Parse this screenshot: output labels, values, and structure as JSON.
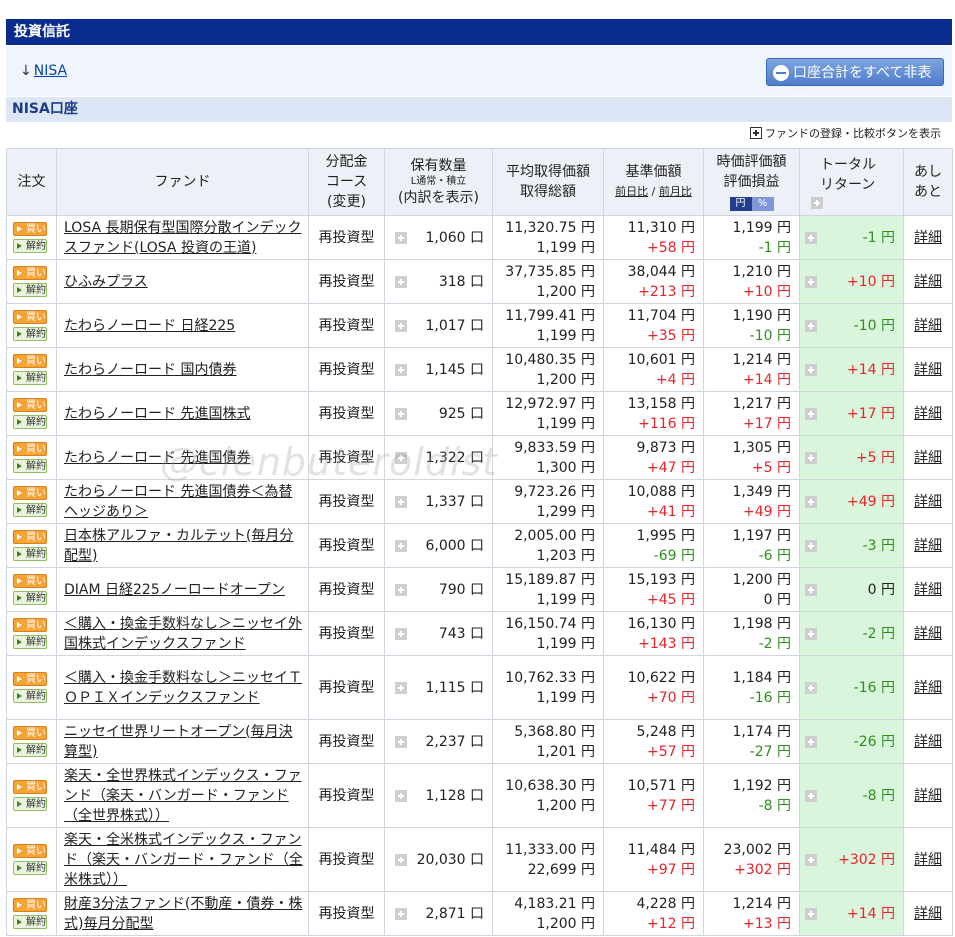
{
  "section_title": "投資信託",
  "nav": {
    "arrow": "↓",
    "nisa_link": "NISA",
    "hide_all_label": "口座合計をすべて非表示"
  },
  "account_title": "NISA口座",
  "compare_label": "ファンドの登録・比較ボタンを表示",
  "headers": {
    "order": "注文",
    "fund": "ファンド",
    "course_l1": "分配金",
    "course_l2": "コース",
    "course_l3": "(変更)",
    "qty_l1": "保有数量",
    "qty_sub": "L通常・積立",
    "qty_l3": "(内訳を表示)",
    "avg_l1": "平均取得価額",
    "avg_l2": "取得総額",
    "base_l1": "基準価額",
    "base_sub_a": "前日比",
    "base_sub_sep": " / ",
    "base_sub_b": "前月比",
    "eval_l1": "時価評価額",
    "eval_l2": "評価損益",
    "toggle_yen": "円",
    "toggle_pct": "%",
    "ret_l1": "トータル",
    "ret_l2": "リターン",
    "ashiato_l1": "あし",
    "ashiato_l2": "あと"
  },
  "buttons": {
    "buy": "買い",
    "sell": "解約",
    "detail": "詳細"
  },
  "rows": [
    {
      "fund": "LOSA 長期保有型国際分散インデックスファンド(LOSA 投資の王道)",
      "course": "再投資型",
      "qty": "1,060 口",
      "avg": "11,320.75 円",
      "total": "1,199 円",
      "base": "11,310 円",
      "base_chg": "+58 円",
      "eval": "1,199 円",
      "pl": "-1 円",
      "ret": "-1 円"
    },
    {
      "fund": "ひふみプラス",
      "course": "再投資型",
      "qty": "318 口",
      "avg": "37,735.85 円",
      "total": "1,200 円",
      "base": "38,044 円",
      "base_chg": "+213 円",
      "eval": "1,210 円",
      "pl": "+10 円",
      "ret": "+10 円"
    },
    {
      "fund": "たわらノーロード 日経225",
      "course": "再投資型",
      "qty": "1,017 口",
      "avg": "11,799.41 円",
      "total": "1,199 円",
      "base": "11,704 円",
      "base_chg": "+35 円",
      "eval": "1,190 円",
      "pl": "-10 円",
      "ret": "-10 円"
    },
    {
      "fund": "たわらノーロード 国内債券",
      "course": "再投資型",
      "qty": "1,145 口",
      "avg": "10,480.35 円",
      "total": "1,200 円",
      "base": "10,601 円",
      "base_chg": "+4 円",
      "eval": "1,214 円",
      "pl": "+14 円",
      "ret": "+14 円"
    },
    {
      "fund": "たわらノーロード 先進国株式",
      "course": "再投資型",
      "qty": "925 口",
      "avg": "12,972.97 円",
      "total": "1,199 円",
      "base": "13,158 円",
      "base_chg": "+116 円",
      "eval": "1,217 円",
      "pl": "+17 円",
      "ret": "+17 円"
    },
    {
      "fund": "たわらノーロード 先進国債券",
      "course": "再投資型",
      "qty": "1,322 口",
      "avg": "9,833.59 円",
      "total": "1,300 円",
      "base": "9,873 円",
      "base_chg": "+47 円",
      "eval": "1,305 円",
      "pl": "+5 円",
      "ret": "+5 円"
    },
    {
      "fund": "たわらノーロード 先進国債券＜為替ヘッジあり＞",
      "course": "再投資型",
      "qty": "1,337 口",
      "avg": "9,723.26 円",
      "total": "1,299 円",
      "base": "10,088 円",
      "base_chg": "+41 円",
      "eval": "1,349 円",
      "pl": "+49 円",
      "ret": "+49 円"
    },
    {
      "fund": "日本株アルファ・カルテット(毎月分配型)",
      "course": "再投資型",
      "qty": "6,000 口",
      "avg": "2,005.00 円",
      "total": "1,203 円",
      "base": "1,995 円",
      "base_chg": "-69 円",
      "eval": "1,197 円",
      "pl": "-6 円",
      "ret": "-3 円"
    },
    {
      "fund": "DIAM 日経225ノーロードオープン",
      "course": "再投資型",
      "qty": "790 口",
      "avg": "15,189.87 円",
      "total": "1,199 円",
      "base": "15,193 円",
      "base_chg": "+45 円",
      "eval": "1,200 円",
      "pl": "0 円",
      "ret": "0 円"
    },
    {
      "fund": "＜購入・換金手数料なし＞ニッセイ外国株式インデックスファンド",
      "course": "再投資型",
      "qty": "743 口",
      "avg": "16,150.74 円",
      "total": "1,199 円",
      "base": "16,130 円",
      "base_chg": "+143 円",
      "eval": "1,198 円",
      "pl": "-2 円",
      "ret": "-2 円"
    },
    {
      "fund": "＜購入・換金手数料なし＞ニッセイＴＯＰＩＸインデックスファンド",
      "course": "再投資型",
      "qty": "1,115 口",
      "avg": "10,762.33 円",
      "total": "1,199 円",
      "base": "10,622 円",
      "base_chg": "+70 円",
      "eval": "1,184 円",
      "pl": "-16 円",
      "ret": "-16 円"
    },
    {
      "fund": "ニッセイ世界リートオープン(毎月決算型)",
      "course": "再投資型",
      "qty": "2,237 口",
      "avg": "5,368.80 円",
      "total": "1,201 円",
      "base": "5,248 円",
      "base_chg": "+57 円",
      "eval": "1,174 円",
      "pl": "-27 円",
      "ret": "-26 円"
    },
    {
      "fund": "楽天・全世界株式インデックス・ファンド（楽天・バンガード・ファンド（全世界株式））",
      "course": "再投資型",
      "qty": "1,128 口",
      "avg": "10,638.30 円",
      "total": "1,200 円",
      "base": "10,571 円",
      "base_chg": "+77 円",
      "eval": "1,192 円",
      "pl": "-8 円",
      "ret": "-8 円"
    },
    {
      "fund": "楽天・全米株式インデックス・ファンド（楽天・バンガード・ファンド（全米株式））",
      "course": "再投資型",
      "qty": "20,030 口",
      "avg": "11,333.00 円",
      "total": "22,699 円",
      "base": "11,484 円",
      "base_chg": "+97 円",
      "eval": "23,002 円",
      "pl": "+302 円",
      "ret": "+302 円"
    },
    {
      "fund": "財産3分法ファンド(不動産・債券・株式)毎月分配型",
      "course": "再投資型",
      "qty": "2,871 口",
      "avg": "4,183.21 円",
      "total": "1,200 円",
      "base": "4,228 円",
      "base_chg": "+12 円",
      "eval": "1,214 円",
      "pl": "+13 円",
      "ret": "+14 円"
    }
  ],
  "watermark": "@clenbuteroldist",
  "colors": {
    "header_bar": "#0a2c8f",
    "positive": "#e8232a",
    "negative": "#2e8f1f",
    "return_bg": "#d9f5dc"
  }
}
